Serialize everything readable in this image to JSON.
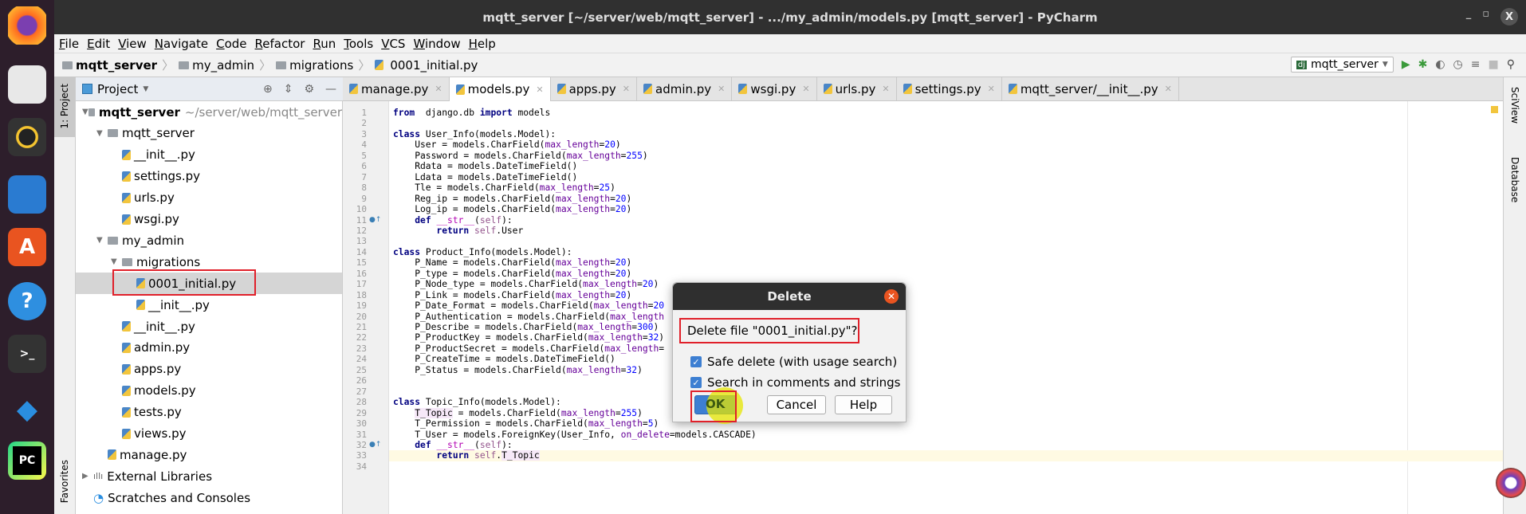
{
  "window": {
    "title": "mqtt_server [~/server/web/mqtt_server] - .../my_admin/models.py [mqtt_server] - PyCharm"
  },
  "dock": [
    "firefox-icon",
    "files-icon",
    "rhythmbox-icon",
    "writer-icon",
    "software-icon",
    "help-icon",
    "terminal-icon",
    "vscode-icon",
    "pycharm-icon"
  ],
  "menu": [
    "File",
    "Edit",
    "View",
    "Navigate",
    "Code",
    "Refactor",
    "Run",
    "Tools",
    "VCS",
    "Window",
    "Help"
  ],
  "breadcrumb": [
    "mqtt_server",
    "my_admin",
    "migrations",
    "0001_initial.py"
  ],
  "run_config": "mqtt_server",
  "project_panel": {
    "title": "Project",
    "stripe_label": "1: Project",
    "favorites_label": "Favorites"
  },
  "tree": [
    {
      "label": "mqtt_server",
      "hint": "~/server/web/mqtt_server",
      "depth": 0,
      "type": "root"
    },
    {
      "label": "mqtt_server",
      "depth": 1,
      "type": "folder"
    },
    {
      "label": "__init__.py",
      "depth": 2,
      "type": "file"
    },
    {
      "label": "settings.py",
      "depth": 2,
      "type": "file"
    },
    {
      "label": "urls.py",
      "depth": 2,
      "type": "file"
    },
    {
      "label": "wsgi.py",
      "depth": 2,
      "type": "file"
    },
    {
      "label": "my_admin",
      "depth": 1,
      "type": "folder"
    },
    {
      "label": "migrations",
      "depth": 2,
      "type": "folder"
    },
    {
      "label": "0001_initial.py",
      "depth": 3,
      "type": "file",
      "selected": true
    },
    {
      "label": "__init__.py",
      "depth": 3,
      "type": "file"
    },
    {
      "label": "__init__.py",
      "depth": 2,
      "type": "file"
    },
    {
      "label": "admin.py",
      "depth": 2,
      "type": "file"
    },
    {
      "label": "apps.py",
      "depth": 2,
      "type": "file"
    },
    {
      "label": "models.py",
      "depth": 2,
      "type": "file"
    },
    {
      "label": "tests.py",
      "depth": 2,
      "type": "file"
    },
    {
      "label": "views.py",
      "depth": 2,
      "type": "file"
    },
    {
      "label": "manage.py",
      "depth": 1,
      "type": "file"
    },
    {
      "label": "External Libraries",
      "depth": 0,
      "type": "lib"
    },
    {
      "label": "Scratches and Consoles",
      "depth": 0,
      "type": "scratch"
    }
  ],
  "tabs": [
    {
      "label": "manage.py"
    },
    {
      "label": "models.py",
      "active": true
    },
    {
      "label": "apps.py"
    },
    {
      "label": "admin.py"
    },
    {
      "label": "wsgi.py"
    },
    {
      "label": "urls.py"
    },
    {
      "label": "settings.py"
    },
    {
      "label": "mqtt_server/__init__.py"
    }
  ],
  "right_stripe": [
    "SciView",
    "Database"
  ],
  "code": [
    [
      [
        "k",
        "from"
      ],
      [
        "",
        "  django.db "
      ],
      [
        "k",
        "import"
      ],
      [
        "",
        " models"
      ]
    ],
    [],
    [
      [
        "k",
        "class"
      ],
      [
        "",
        " User_Info(models.Model):"
      ]
    ],
    [
      [
        "",
        "    User = models.CharField("
      ],
      [
        "p",
        "max_length"
      ],
      [
        "",
        "="
      ],
      [
        "n",
        "20"
      ],
      [
        "",
        ")"
      ]
    ],
    [
      [
        "",
        "    Password = models.CharField("
      ],
      [
        "p",
        "max_length"
      ],
      [
        "",
        "="
      ],
      [
        "n",
        "255"
      ],
      [
        "",
        ")"
      ]
    ],
    [
      [
        "",
        "    Rdata = models.DateTimeField()"
      ]
    ],
    [
      [
        "",
        "    Ldata = models.DateTimeField()"
      ]
    ],
    [
      [
        "",
        "    Tle = models.CharField("
      ],
      [
        "p",
        "max_length"
      ],
      [
        "",
        "="
      ],
      [
        "n",
        "25"
      ],
      [
        "",
        ")"
      ]
    ],
    [
      [
        "",
        "    Reg_ip = models.CharField("
      ],
      [
        "p",
        "max_length"
      ],
      [
        "",
        "="
      ],
      [
        "n",
        "20"
      ],
      [
        "",
        ")"
      ]
    ],
    [
      [
        "",
        "    Log_ip = models.CharField("
      ],
      [
        "p",
        "max_length"
      ],
      [
        "",
        "="
      ],
      [
        "n",
        "20"
      ],
      [
        "",
        ")"
      ]
    ],
    [
      [
        "",
        "    "
      ],
      [
        "k",
        "def"
      ],
      [
        "",
        " "
      ],
      [
        "f",
        "__str__"
      ],
      [
        "",
        "("
      ],
      [
        "s",
        "self"
      ],
      [
        "",
        "):"
      ]
    ],
    [
      [
        "",
        "        "
      ],
      [
        "k",
        "return"
      ],
      [
        "",
        " "
      ],
      [
        "s",
        "self"
      ],
      [
        "",
        ".User"
      ]
    ],
    [],
    [
      [
        "k",
        "class"
      ],
      [
        "",
        " Product_Info(models.Model):"
      ]
    ],
    [
      [
        "",
        "    P_Name = models.CharField("
      ],
      [
        "p",
        "max_length"
      ],
      [
        "",
        "="
      ],
      [
        "n",
        "20"
      ],
      [
        "",
        ")"
      ]
    ],
    [
      [
        "",
        "    P_type = models.CharField("
      ],
      [
        "p",
        "max_length"
      ],
      [
        "",
        "="
      ],
      [
        "n",
        "20"
      ],
      [
        "",
        ")"
      ]
    ],
    [
      [
        "",
        "    P_Node_type = models.CharField("
      ],
      [
        "p",
        "max_length"
      ],
      [
        "",
        "="
      ],
      [
        "n",
        "20"
      ],
      [
        "",
        ")"
      ]
    ],
    [
      [
        "",
        "    P_Link = models.CharField("
      ],
      [
        "p",
        "max_length"
      ],
      [
        "",
        "="
      ],
      [
        "n",
        "20"
      ],
      [
        "",
        ")"
      ]
    ],
    [
      [
        "",
        "    P_Date_Format = models.CharField("
      ],
      [
        "p",
        "max_length"
      ],
      [
        "",
        "="
      ],
      [
        "n",
        "20"
      ]
    ],
    [
      [
        "",
        "    P_Authentication = models.CharField("
      ],
      [
        "p",
        "max_length"
      ]
    ],
    [
      [
        "",
        "    P_Describe = models.CharField("
      ],
      [
        "p",
        "max_length"
      ],
      [
        "",
        "="
      ],
      [
        "n",
        "300"
      ],
      [
        "",
        ")"
      ]
    ],
    [
      [
        "",
        "    P_ProductKey = models.CharField("
      ],
      [
        "p",
        "max_length"
      ],
      [
        "",
        "="
      ],
      [
        "n",
        "32"
      ],
      [
        "",
        ")"
      ]
    ],
    [
      [
        "",
        "    P_ProductSecret = models.CharField("
      ],
      [
        "p",
        "max_length"
      ],
      [
        "",
        "="
      ]
    ],
    [
      [
        "",
        "    P_CreateTime = models.DateTimeField()"
      ]
    ],
    [
      [
        "",
        "    P_Status = models.CharField("
      ],
      [
        "p",
        "max_length"
      ],
      [
        "",
        "="
      ],
      [
        "n",
        "32"
      ],
      [
        "",
        ")"
      ]
    ],
    [],
    [],
    [
      [
        "k",
        "class"
      ],
      [
        "",
        " Topic_Info(models.Model):"
      ]
    ],
    [
      [
        "",
        "    "
      ],
      [
        "h",
        "T_Topic"
      ],
      [
        "",
        " = models.CharField("
      ],
      [
        "p",
        "max_length"
      ],
      [
        "",
        "="
      ],
      [
        "n",
        "255"
      ],
      [
        "",
        ")"
      ]
    ],
    [
      [
        "",
        "    T_Permission = models.CharField("
      ],
      [
        "p",
        "max_length"
      ],
      [
        "",
        "="
      ],
      [
        "n",
        "5"
      ],
      [
        "",
        ")"
      ]
    ],
    [
      [
        "",
        "    T_User = models.ForeignKey(User_Info, "
      ],
      [
        "p",
        "on_delete"
      ],
      [
        "",
        "=models.CASCADE)"
      ]
    ],
    [
      [
        "",
        "    "
      ],
      [
        "k",
        "def"
      ],
      [
        "",
        " "
      ],
      [
        "f",
        "__str__"
      ],
      [
        "",
        "("
      ],
      [
        "s",
        "self"
      ],
      [
        "",
        "):"
      ]
    ],
    [
      [
        "",
        "        "
      ],
      [
        "k",
        "return"
      ],
      [
        "",
        " "
      ],
      [
        "s",
        "self"
      ],
      [
        "",
        "."
      ],
      [
        "h",
        "T_Topic"
      ]
    ],
    []
  ],
  "current_line": 33,
  "override_marks": [
    11,
    32
  ],
  "dialog": {
    "title": "Delete",
    "message": "Delete file \"0001_initial.py\"?",
    "safe_delete": {
      "label": "Safe delete (with usage search)",
      "checked": true
    },
    "search_comments": {
      "label": "Search in comments and strings",
      "checked": true
    },
    "ok": "OK",
    "cancel": "Cancel",
    "help": "Help"
  }
}
